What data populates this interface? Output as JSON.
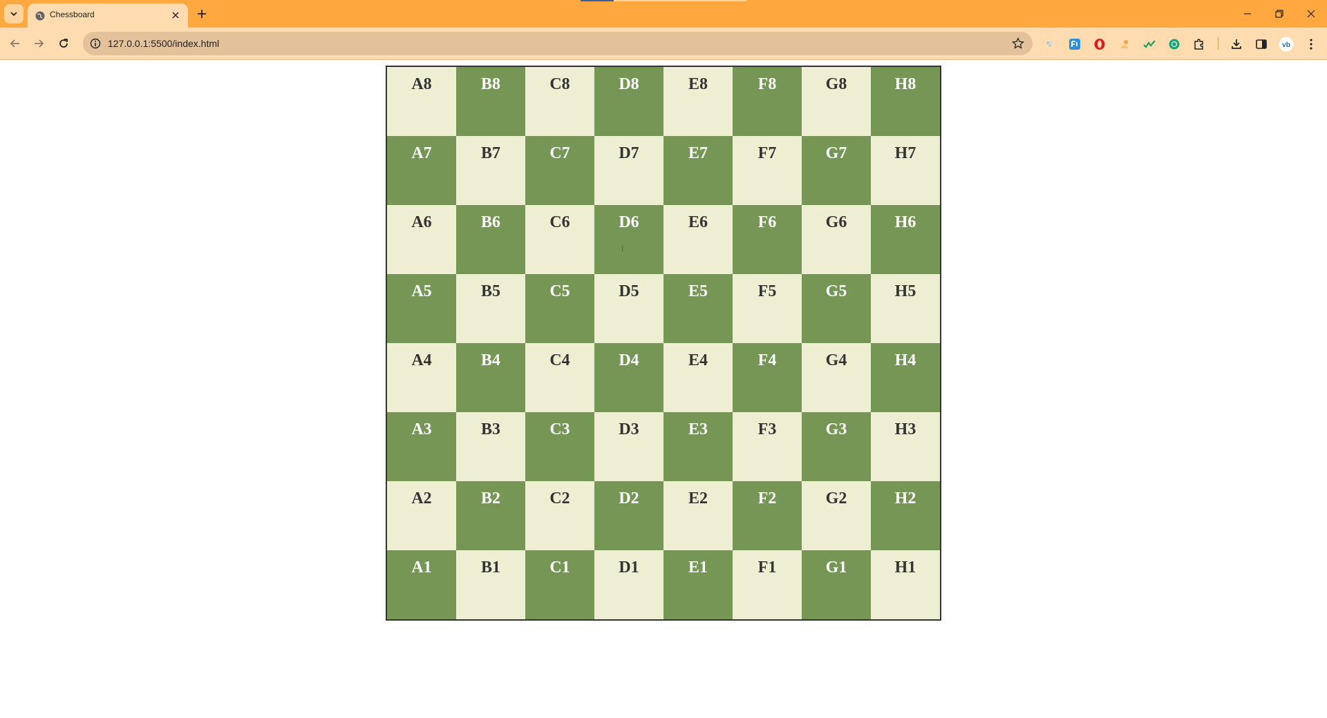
{
  "browser": {
    "tab_title": "Chessboard",
    "url": "127.0.0.1:5500/index.html",
    "accent_color": "#ffa83f",
    "toolbar_color": "#ffdcb0",
    "icons": [
      "chevron-down-icon",
      "globe-icon",
      "close-icon",
      "plus-icon",
      "back-arrow-icon",
      "forward-arrow-icon",
      "reload-icon",
      "info-icon",
      "star-icon",
      "extension-icons",
      "puzzle-icon",
      "download-icon",
      "side-panel-icon",
      "profile-icon",
      "menu-icon",
      "minimize-icon",
      "restore-icon",
      "window-close-icon"
    ]
  },
  "board": {
    "light_color": "#eeeed2",
    "dark_color": "#769656",
    "border_color": "#333333",
    "rows": [
      [
        "A8",
        "B8",
        "C8",
        "D8",
        "E8",
        "F8",
        "G8",
        "H8"
      ],
      [
        "A7",
        "B7",
        "C7",
        "D7",
        "E7",
        "F7",
        "G7",
        "H7"
      ],
      [
        "A6",
        "B6",
        "C6",
        "D6",
        "E6",
        "F6",
        "G6",
        "H6"
      ],
      [
        "A5",
        "B5",
        "C5",
        "D5",
        "E5",
        "F5",
        "G5",
        "H5"
      ],
      [
        "A4",
        "B4",
        "C4",
        "D4",
        "E4",
        "F4",
        "G4",
        "H4"
      ],
      [
        "A3",
        "B3",
        "C3",
        "D3",
        "E3",
        "F3",
        "G3",
        "H3"
      ],
      [
        "A2",
        "B2",
        "C2",
        "D2",
        "E2",
        "F2",
        "G2",
        "H2"
      ],
      [
        "A1",
        "B1",
        "C1",
        "D1",
        "E1",
        "F1",
        "G1",
        "H1"
      ]
    ]
  }
}
